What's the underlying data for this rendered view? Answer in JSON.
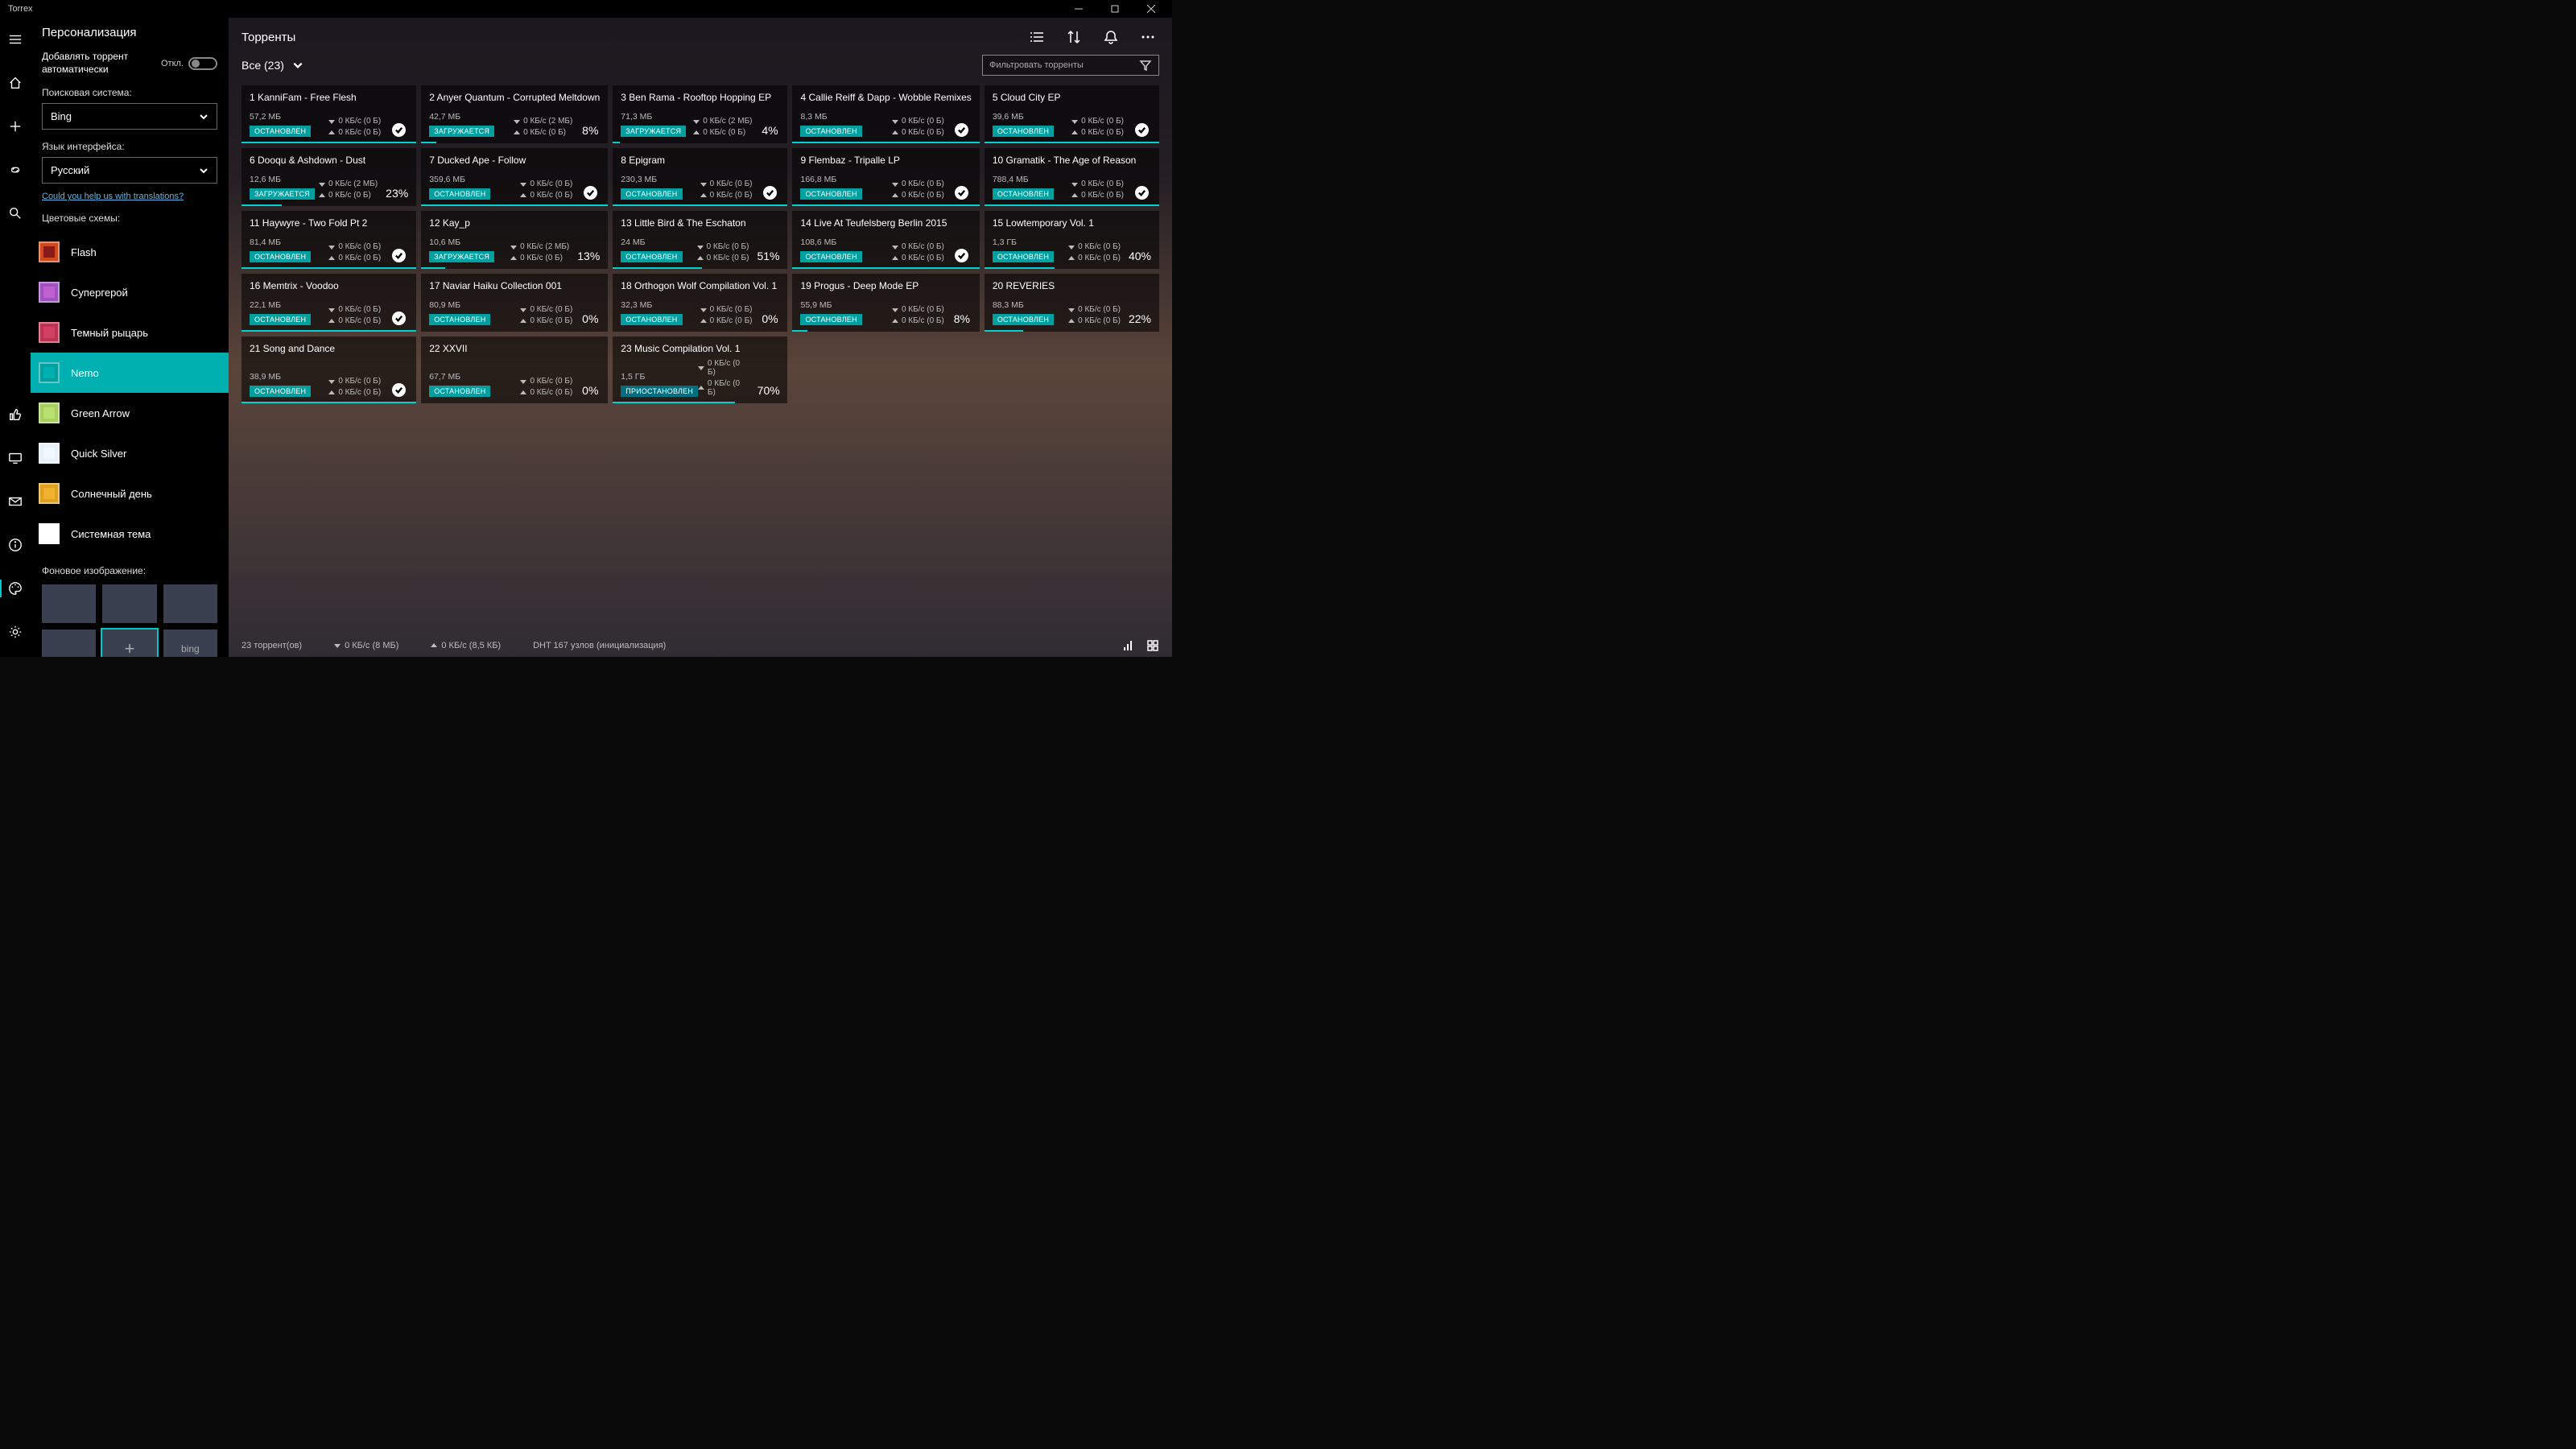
{
  "window": {
    "title": "Torrex"
  },
  "sidebar": {
    "title": "Персонализация",
    "autoAdd": {
      "label": "Добавлять торрент автоматически",
      "state": "Откл."
    },
    "searchEngine": {
      "label": "Поисковая система:",
      "value": "Bing"
    },
    "language": {
      "label": "Язык интерфейса:",
      "value": "Русский"
    },
    "translateLink": "Could you help us with translations?",
    "themes": {
      "label": "Цветовые схемы:",
      "items": [
        {
          "label": "Flash",
          "color": "#d04a1a",
          "inner": "#8a1a1a"
        },
        {
          "label": "Супергерой",
          "color": "#a050c0",
          "inner": "#c060d0"
        },
        {
          "label": "Темный рыцарь",
          "color": "#c03050",
          "inner": "#d04060"
        },
        {
          "label": "Nemo",
          "color": "#00a0a0",
          "inner": "#00b0b0",
          "selected": true
        },
        {
          "label": "Green Arrow",
          "color": "#a8d060",
          "inner": "#b8e070"
        },
        {
          "label": "Quick Silver",
          "color": "#e8f0f8",
          "inner": "#f0f8ff"
        },
        {
          "label": "Солнечный день",
          "color": "#e0a020",
          "inner": "#f0b030"
        },
        {
          "label": "Системная тема",
          "color": "#ffffff",
          "inner": "#ffffff"
        }
      ]
    },
    "backgrounds": {
      "label": "Фоновое изображение:",
      "items": [
        {
          "label": ""
        },
        {
          "label": ""
        },
        {
          "label": ""
        },
        {
          "label": ""
        },
        {
          "label": "+",
          "selected": true
        },
        {
          "label": "bing"
        }
      ]
    }
  },
  "header": {
    "title": "Торренты"
  },
  "subheader": {
    "filterLabel": "Все (23)",
    "searchPlaceholder": "Фильтровать торренты"
  },
  "torrents": [
    {
      "title": "1 KanniFam - Free Flesh",
      "size": "57,2 МБ",
      "down": "0 КБ/с (0 Б)",
      "up": "0 КБ/с (0 Б)",
      "status": "ОСТАНОВЛЕН",
      "statusType": "stopped",
      "complete": true,
      "progress": 100
    },
    {
      "title": "2 Anyer Quantum - Corrupted Meltdown",
      "size": "42,7 МБ",
      "down": "0 КБ/с (2 МБ)",
      "up": "0 КБ/с (0 Б)",
      "status": "ЗАГРУЖАЕТСЯ",
      "statusType": "downloading",
      "percent": "8%",
      "progress": 8
    },
    {
      "title": "3 Ben Rama - Rooftop Hopping EP",
      "size": "71,3 МБ",
      "down": "0 КБ/с (2 МБ)",
      "up": "0 КБ/с (0 Б)",
      "status": "ЗАГРУЖАЕТСЯ",
      "statusType": "downloading",
      "percent": "4%",
      "progress": 4
    },
    {
      "title": "4 Callie Reiff & Dapp - Wobble Remixes",
      "size": "8,3 МБ",
      "down": "0 КБ/с (0 Б)",
      "up": "0 КБ/с (0 Б)",
      "status": "ОСТАНОВЛЕН",
      "statusType": "stopped",
      "complete": true,
      "progress": 100
    },
    {
      "title": "5 Cloud City EP",
      "size": "39,6 МБ",
      "down": "0 КБ/с (0 Б)",
      "up": "0 КБ/с (0 Б)",
      "status": "ОСТАНОВЛЕН",
      "statusType": "stopped",
      "complete": true,
      "progress": 100
    },
    {
      "title": "6 Dooqu & Ashdown - Dust",
      "size": "12,6 МБ",
      "down": "0 КБ/с (2 МБ)",
      "up": "0 КБ/с (0 Б)",
      "status": "ЗАГРУЖАЕТСЯ",
      "statusType": "downloading",
      "percent": "23%",
      "progress": 23
    },
    {
      "title": "7 Ducked Ape - Follow",
      "size": "359,6 МБ",
      "down": "0 КБ/с (0 Б)",
      "up": "0 КБ/с (0 Б)",
      "status": "ОСТАНОВЛЕН",
      "statusType": "stopped",
      "complete": true,
      "progress": 100
    },
    {
      "title": "8 Epigram",
      "size": "230,3 МБ",
      "down": "0 КБ/с (0 Б)",
      "up": "0 КБ/с (0 Б)",
      "status": "ОСТАНОВЛЕН",
      "statusType": "stopped",
      "complete": true,
      "progress": 100
    },
    {
      "title": "9 Flembaz - Tripalle LP",
      "size": "166,8 МБ",
      "down": "0 КБ/с (0 Б)",
      "up": "0 КБ/с (0 Б)",
      "status": "ОСТАНОВЛЕН",
      "statusType": "stopped",
      "complete": true,
      "progress": 100
    },
    {
      "title": "10 Gramatik - The Age of Reason",
      "size": "788,4 МБ",
      "down": "0 КБ/с (0 Б)",
      "up": "0 КБ/с (0 Б)",
      "status": "ОСТАНОВЛЕН",
      "statusType": "stopped",
      "complete": true,
      "progress": 100
    },
    {
      "title": "11 Haywyre - Two Fold Pt 2",
      "size": "81,4 МБ",
      "down": "0 КБ/с (0 Б)",
      "up": "0 КБ/с (0 Б)",
      "status": "ОСТАНОВЛЕН",
      "statusType": "stopped",
      "complete": true,
      "progress": 100
    },
    {
      "title": "12 Kay_p",
      "size": "10,6 МБ",
      "down": "0 КБ/с (2 МБ)",
      "up": "0 КБ/с (0 Б)",
      "status": "ЗАГРУЖАЕТСЯ",
      "statusType": "downloading",
      "percent": "13%",
      "progress": 13
    },
    {
      "title": "13 Little Bird & The Eschaton",
      "size": "24 МБ",
      "down": "0 КБ/с (0 Б)",
      "up": "0 КБ/с (0 Б)",
      "status": "ОСТАНОВЛЕН",
      "statusType": "stopped",
      "percent": "51%",
      "progress": 51
    },
    {
      "title": "14 Live At Teufelsberg Berlin 2015",
      "size": "108,6 МБ",
      "down": "0 КБ/с (0 Б)",
      "up": "0 КБ/с (0 Б)",
      "status": "ОСТАНОВЛЕН",
      "statusType": "stopped",
      "complete": true,
      "progress": 100
    },
    {
      "title": "15 Lowtemporary Vol. 1",
      "size": "1,3 ГБ",
      "down": "0 КБ/с (0 Б)",
      "up": "0 КБ/с (0 Б)",
      "status": "ОСТАНОВЛЕН",
      "statusType": "stopped",
      "percent": "40%",
      "progress": 40
    },
    {
      "title": "16 Memtrix - Voodoo",
      "size": "22,1 МБ",
      "down": "0 КБ/с (0 Б)",
      "up": "0 КБ/с (0 Б)",
      "status": "ОСТАНОВЛЕН",
      "statusType": "stopped",
      "complete": true,
      "progress": 100
    },
    {
      "title": "17 Naviar Haiku Collection 001",
      "size": "80,9 МБ",
      "down": "0 КБ/с (0 Б)",
      "up": "0 КБ/с (0 Б)",
      "status": "ОСТАНОВЛЕН",
      "statusType": "stopped",
      "percent": "0%",
      "progress": 0
    },
    {
      "title": "18 Orthogon Wolf Compilation Vol. 1",
      "size": "32,3 МБ",
      "down": "0 КБ/с (0 Б)",
      "up": "0 КБ/с (0 Б)",
      "status": "ОСТАНОВЛЕН",
      "statusType": "stopped",
      "percent": "0%",
      "progress": 0
    },
    {
      "title": "19 Progus - Deep Mode EP",
      "size": "55,9 МБ",
      "down": "0 КБ/с (0 Б)",
      "up": "0 КБ/с (0 Б)",
      "status": "ОСТАНОВЛЕН",
      "statusType": "stopped",
      "percent": "8%",
      "progress": 8
    },
    {
      "title": "20 REVERIES",
      "size": "88,3 МБ",
      "down": "0 КБ/с (0 Б)",
      "up": "0 КБ/с (0 Б)",
      "status": "ОСТАНОВЛЕН",
      "statusType": "stopped",
      "percent": "22%",
      "progress": 22
    },
    {
      "title": "21 Song and Dance",
      "size": "38,9 МБ",
      "down": "0 КБ/с (0 Б)",
      "up": "0 КБ/с (0 Б)",
      "status": "ОСТАНОВЛЕН",
      "statusType": "stopped",
      "complete": true,
      "progress": 100
    },
    {
      "title": "22 XXVII",
      "size": "67,7 МБ",
      "down": "0 КБ/с (0 Б)",
      "up": "0 КБ/с (0 Б)",
      "status": "ОСТАНОВЛЕН",
      "statusType": "stopped",
      "percent": "0%",
      "progress": 0
    },
    {
      "title": "23 Music Compilation Vol. 1",
      "size": "1,5 ГБ",
      "down": "0 КБ/с (0 Б)",
      "up": "0 КБ/с (0 Б)",
      "status": "ПРИОСТАНОВЛЕН",
      "statusType": "paused",
      "percent": "70%",
      "progress": 70
    }
  ],
  "statusbar": {
    "torrents": "23 торрент(ов)",
    "down": "0 КБ/с (8 МБ)",
    "up": "0 КБ/с (8,5 КБ)",
    "dht": "DHT 167 узлов (инициализация)"
  }
}
